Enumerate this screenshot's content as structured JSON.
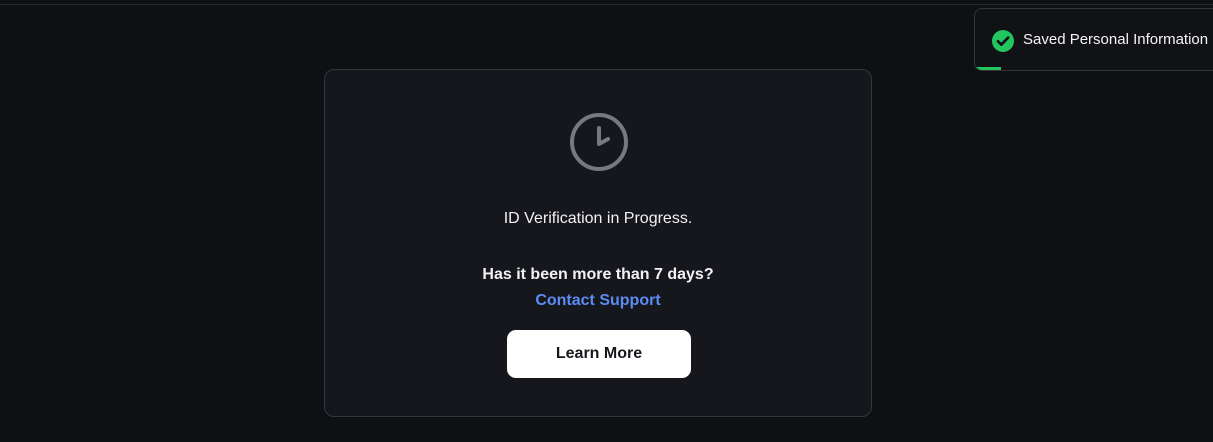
{
  "toast": {
    "message": "Saved Personal Information",
    "icon": "check-circle-icon",
    "accent_color": "#22c55e",
    "progress": 0.1
  },
  "verification": {
    "icon": "clock-icon",
    "status_title": "ID Verification in Progress.",
    "question": "Has it been more than 7 days?",
    "support_link": "Contact Support",
    "learn_more_label": "Learn More"
  },
  "colors": {
    "background": "#0f1014",
    "card": "#16171c",
    "link": "#5b8cf3",
    "button": "#ffffff"
  }
}
